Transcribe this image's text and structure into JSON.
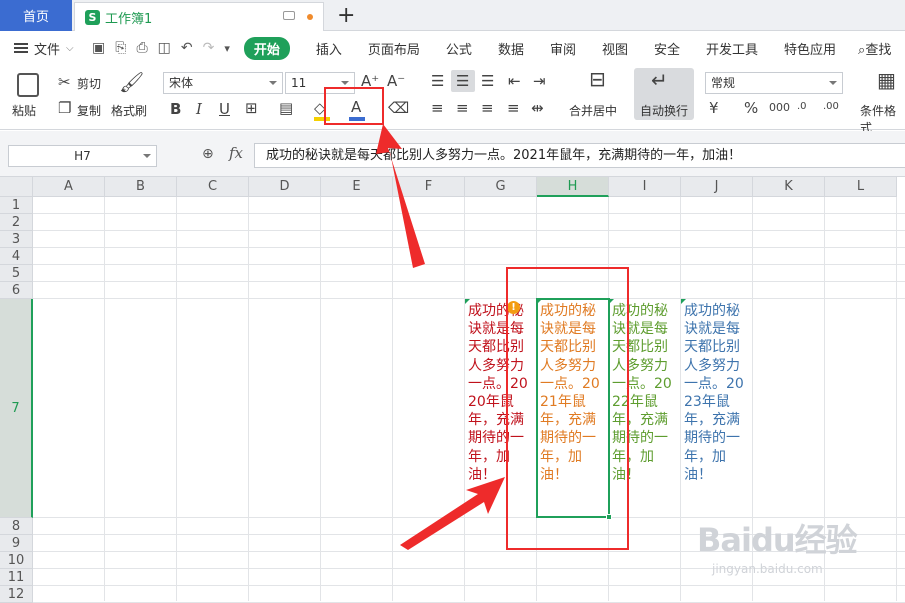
{
  "tabs": {
    "home": "首页",
    "doc_icon": "S",
    "doc": "工作簿1",
    "add": "+"
  },
  "menu": {
    "file": "文件",
    "items": [
      "开始",
      "插入",
      "页面布局",
      "公式",
      "数据",
      "审阅",
      "视图",
      "安全",
      "开发工具",
      "特色应用",
      "查找"
    ]
  },
  "ribbon": {
    "paste": "粘贴",
    "cut": "剪切",
    "copy": "复制",
    "format_painter": "格式刷",
    "font_name": "宋体",
    "font_size": "11",
    "merge_center": "合并居中",
    "auto_wrap": "自动换行",
    "number_format": "常规",
    "conditional_format": "条件格式"
  },
  "formula_bar": {
    "name_box": "H7",
    "fx": "fx",
    "formula": "成功的秘诀就是每天都比别人多努力一点。2021年鼠年，充满期待的一年，加油！"
  },
  "grid": {
    "columns": [
      "A",
      "B",
      "C",
      "D",
      "E",
      "F",
      "G",
      "H",
      "I",
      "J",
      "K",
      "L"
    ],
    "selected_column": "H",
    "rows": [
      "1",
      "2",
      "3",
      "4",
      "5",
      "6",
      "7",
      "8",
      "9",
      "10",
      "11",
      "12"
    ],
    "selected_row": "7",
    "cells": {
      "G7": {
        "text": "成功的秘诀就是每天都比别人多努力一点。2020年鼠年，充满期待的一年，加油！",
        "color": "#c0121c"
      },
      "H7": {
        "text": "成功的秘诀就是每天都比别人多努力一点。2021年鼠年，充满期待的一年，加油！",
        "color": "#e07b23"
      },
      "I7": {
        "text": "成功的秘诀就是每天都比别人多努力一点。2022年鼠年，充满期待的一年，加油！",
        "color": "#5e9d2f"
      },
      "J7": {
        "text": "成功的秘诀就是每天都比别人多努力一点。2023年鼠年，充满期待的一年，加油！",
        "color": "#3e74ad"
      }
    }
  },
  "watermark": {
    "brand": "Baidu经验",
    "url": "jingyan.baidu.com"
  },
  "colors": {
    "accent": "#1fa05a",
    "tab_blue": "#3b6cd1",
    "annotation_red": "#ee2b2b"
  }
}
